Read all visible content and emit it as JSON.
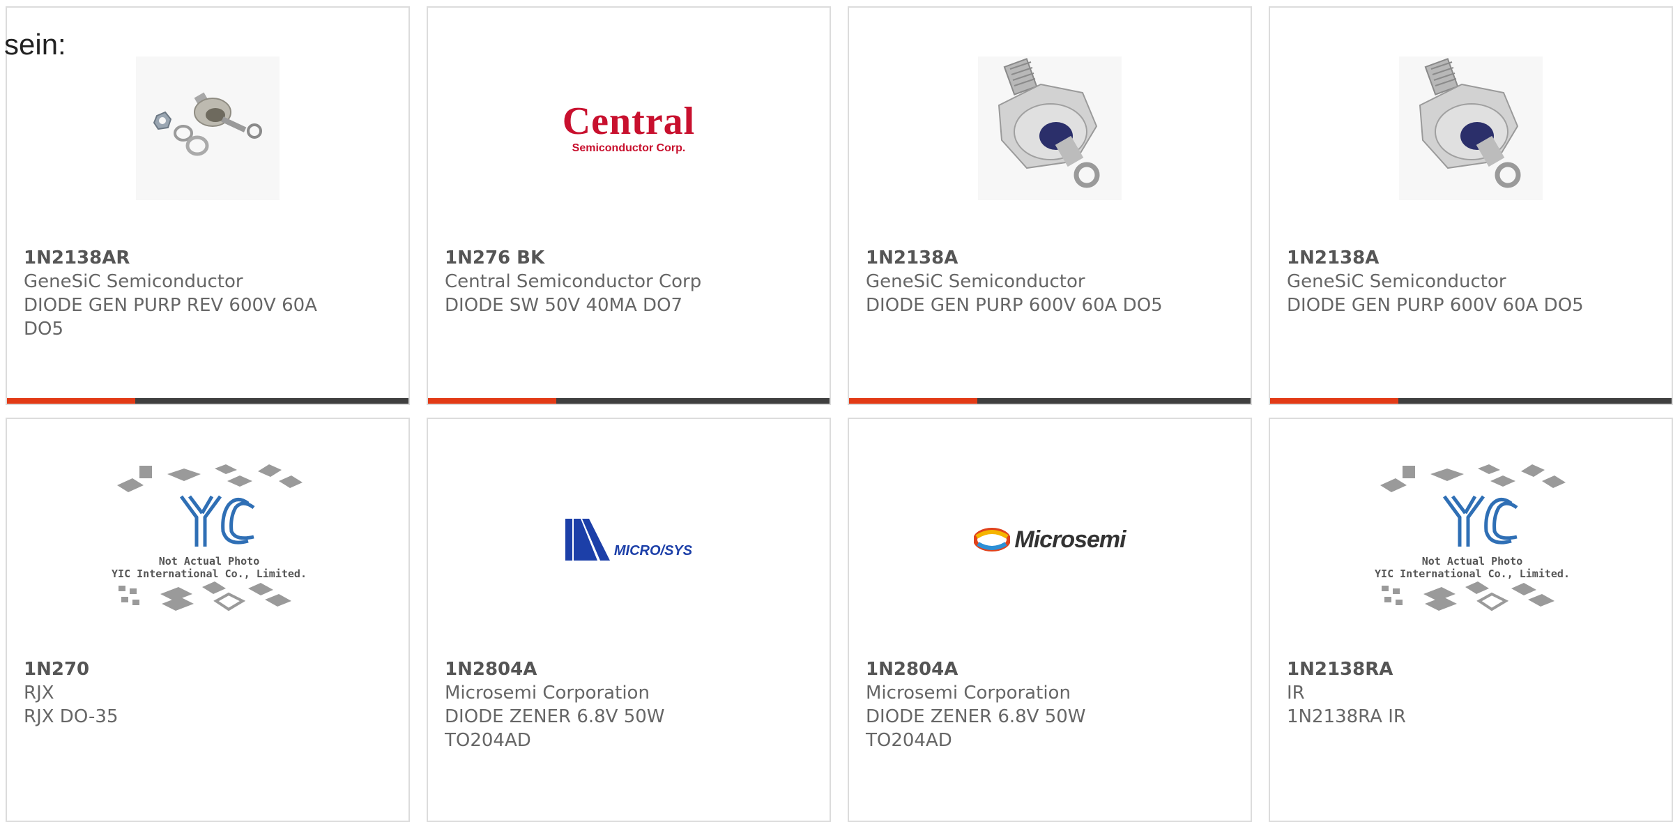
{
  "intro_text": "sein:",
  "colors": {
    "accent": "#e23a16",
    "bar": "#3f3f3f",
    "border": "#dcdcdc",
    "text": "#666666"
  },
  "products": [
    {
      "part": "1N2138AR",
      "manufacturer": "GeneSiC Semiconductor",
      "description": "DIODE GEN PURP REV 600V 60A DO5",
      "image": "stud-diode-with-washers-photo"
    },
    {
      "part": "1N276 BK",
      "manufacturer": "Central Semiconductor Corp",
      "description": "DIODE SW 50V 40MA DO7",
      "image": "central-semiconductor-logo",
      "logo_big": "Central",
      "logo_small": "Semiconductor Corp."
    },
    {
      "part": "1N2138A",
      "manufacturer": "GeneSiC Semiconductor",
      "description": "DIODE GEN PURP 600V 60A DO5",
      "image": "stud-diode-photo"
    },
    {
      "part": "1N2138A",
      "manufacturer": "GeneSiC Semiconductor",
      "description": "DIODE GEN PURP 600V 60A DO5",
      "image": "stud-diode-photo"
    },
    {
      "part": "1N270",
      "manufacturer": "RJX",
      "description": "RJX DO-35",
      "image": "yic-placeholder",
      "note_line1": "Not Actual Photo",
      "note_line2": "YIC International Co., Limited."
    },
    {
      "part": "1N2804A",
      "manufacturer": "Microsemi Corporation",
      "description": "DIODE ZENER 6.8V 50W TO204AD",
      "image": "microsys-logo",
      "logo_text": "MICRO/SYS"
    },
    {
      "part": "1N2804A",
      "manufacturer": "Microsemi Corporation",
      "description": "DIODE ZENER 6.8V 50W TO204AD",
      "image": "microsemi-logo",
      "logo_text": "Microsemi"
    },
    {
      "part": "1N2138RA",
      "manufacturer": "IR",
      "description": "1N2138RA IR",
      "image": "yic-placeholder",
      "note_line1": "Not Actual Photo",
      "note_line2": "YIC International Co., Limited."
    }
  ]
}
